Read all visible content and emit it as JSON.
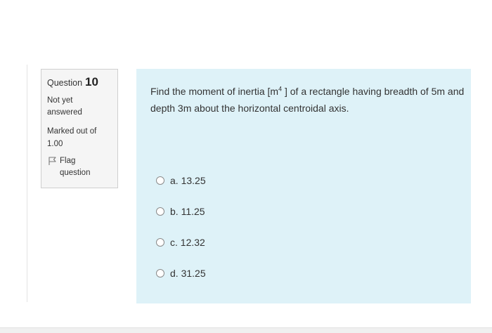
{
  "info": {
    "question_word": "Question",
    "question_number": "10",
    "state_line1": "Not yet",
    "state_line2": "answered",
    "grade_line1": "Marked out of",
    "grade_line2": "1.00",
    "flag_line1": "Flag",
    "flag_line2": "question",
    "flag_icon": "flag-icon"
  },
  "question": {
    "text_before_sup": "Find the moment of inertia [m",
    "sup": "4",
    "text_after_sup": " ] of a rectangle having breadth of 5m and depth 3m about the horizontal centroidal axis."
  },
  "answers": [
    {
      "label": "a. 13.25",
      "selected": false
    },
    {
      "label": "b. 11.25",
      "selected": false
    },
    {
      "label": "c. 12.32",
      "selected": false
    },
    {
      "label": "d. 31.25",
      "selected": false
    }
  ],
  "colors": {
    "content_bg": "#def2f8",
    "info_bg": "#f5f5f5",
    "info_border": "#cfcfcf"
  }
}
